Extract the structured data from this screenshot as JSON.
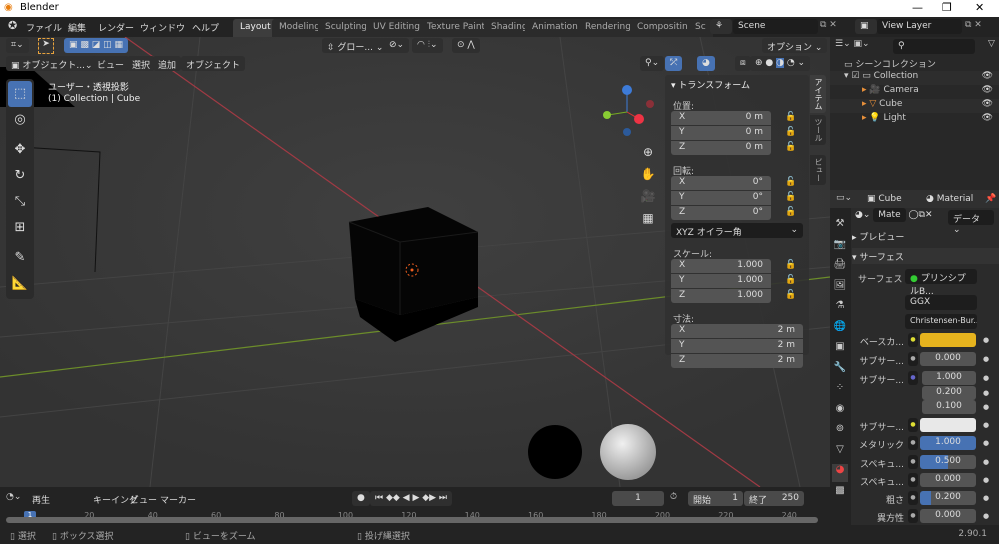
{
  "window": {
    "title": "Blender",
    "minimize": "—",
    "maximize": "❐",
    "close": "✕"
  },
  "menu": [
    "ファイル",
    "編集",
    "レンダー",
    "ウィンドウ",
    "ヘルプ"
  ],
  "workspaces": [
    "Layout",
    "Modeling",
    "Sculpting",
    "UV Editing",
    "Texture Paint",
    "Shading",
    "Animation",
    "Rendering",
    "Compositing",
    "Sc"
  ],
  "active_workspace": "Layout",
  "scene": "Scene",
  "view_layer": "View Layer",
  "tool_header": {
    "transform_orientation": "グロー...",
    "options": "オプション"
  },
  "viewport_header": {
    "mode": "オブジェクト...",
    "menus": [
      "ビュー",
      "選択",
      "追加",
      "オブジェクト"
    ]
  },
  "viewport": {
    "view_name": "ユーザー・透視投影",
    "context": "(1) Collection | Cube",
    "gizmo_axes": [
      "X",
      "Y",
      "Z"
    ]
  },
  "npanel": {
    "title": "トランスフォーム",
    "location_label": "位置:",
    "location": [
      {
        "k": "X",
        "v": "0 m"
      },
      {
        "k": "Y",
        "v": "0 m"
      },
      {
        "k": "Z",
        "v": "0 m"
      }
    ],
    "rotation_label": "回転:",
    "rotation": [
      {
        "k": "X",
        "v": "0°"
      },
      {
        "k": "Y",
        "v": "0°"
      },
      {
        "k": "Z",
        "v": "0°"
      }
    ],
    "rotation_mode": "XYZ オイラー角",
    "scale_label": "スケール:",
    "scale": [
      {
        "k": "X",
        "v": "1.000"
      },
      {
        "k": "Y",
        "v": "1.000"
      },
      {
        "k": "Z",
        "v": "1.000"
      }
    ],
    "dimensions_label": "寸法:",
    "dimensions": [
      {
        "k": "X",
        "v": "2 m"
      },
      {
        "k": "Y",
        "v": "2 m"
      },
      {
        "k": "Z",
        "v": "2 m"
      }
    ],
    "tabs": [
      "アイテム",
      "ツール",
      "ビュー"
    ]
  },
  "outliner": {
    "root": "シーンコレクション",
    "collection": "Collection",
    "items": [
      "Camera",
      "Cube",
      "Light"
    ]
  },
  "properties": {
    "object": "Cube",
    "material": "Material",
    "slot": "Mate",
    "data_dropdown": "データ",
    "preview": "プレビュー",
    "surface_panel": "サーフェス",
    "surface_label": "サーフェス",
    "surface_shader": "プリンシプルB...",
    "distribution": "GGX",
    "subsurface_method": "Christensen-Bur...",
    "rows": [
      {
        "label": "ベースカ...",
        "value": "",
        "color": "#e6b31e"
      },
      {
        "label": "サブサー...",
        "value": "0.000"
      },
      {
        "label": "サブサー...",
        "values": [
          "1.000",
          "0.200",
          "0.100"
        ]
      },
      {
        "label": "サブサー...",
        "value": "",
        "color": "#e8e8e8"
      },
      {
        "label": "メタリック",
        "value": "1.000",
        "fill": 1.0
      },
      {
        "label": "スペキュ...",
        "value": "0.500",
        "fill": 0.5
      },
      {
        "label": "スペキュ...",
        "value": "0.000"
      },
      {
        "label": "粗さ",
        "value": "0.200",
        "fill": 0.2
      },
      {
        "label": "異方性",
        "value": "0.000"
      }
    ]
  },
  "timeline": {
    "menus": [
      "再生",
      "キーイング",
      "ビュー",
      "マーカー"
    ],
    "current_frame": "1",
    "start_label": "開始",
    "start": "1",
    "end_label": "終了",
    "end": "250",
    "ticks": [
      "20",
      "40",
      "60",
      "80",
      "100",
      "120",
      "140",
      "160",
      "180",
      "200",
      "220",
      "240"
    ],
    "playhead": "1"
  },
  "statusbar": {
    "items": [
      "選択",
      "ボックス選択",
      "ビューをズーム",
      "投げ縄選択"
    ],
    "version": "2.90.1"
  },
  "colors": {
    "accent": "#4772b3",
    "base_color": "#e6b31e",
    "header": "#232323",
    "viewport": "#393939"
  }
}
